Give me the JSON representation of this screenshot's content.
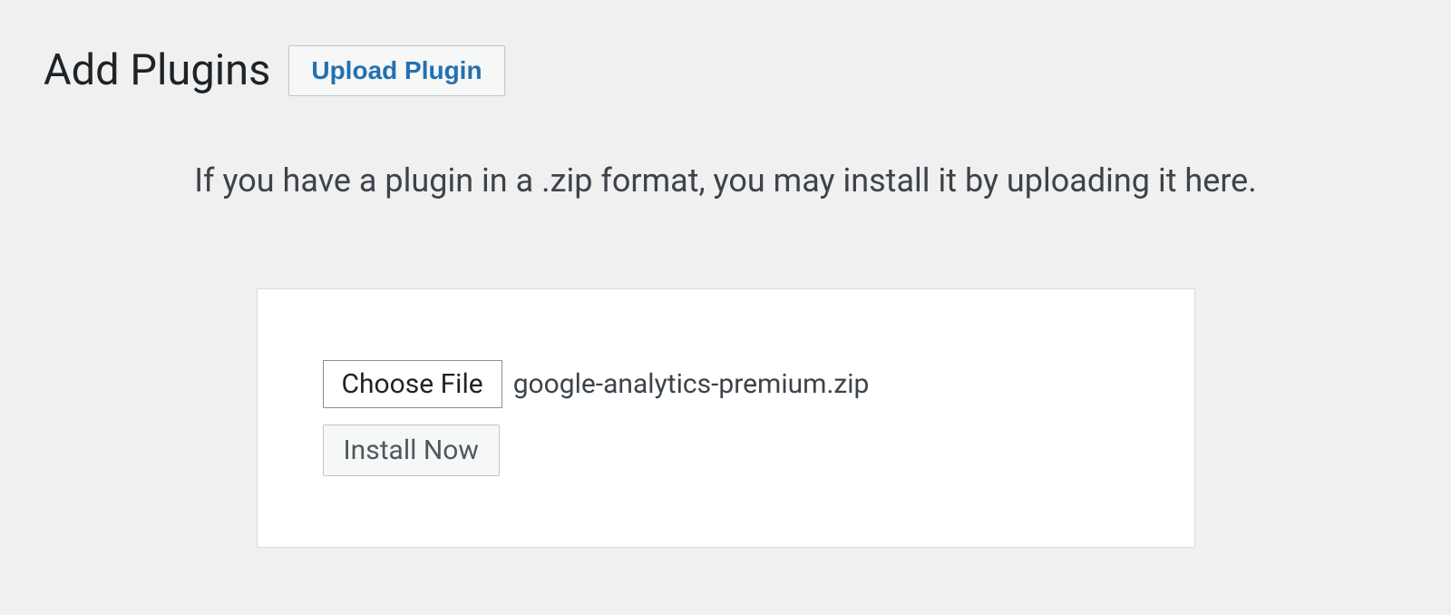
{
  "header": {
    "title": "Add Plugins",
    "upload_button": "Upload Plugin"
  },
  "help_text": "If you have a plugin in a .zip format, you may install it by uploading it here.",
  "form": {
    "choose_file_label": "Choose File",
    "selected_file": "google-analytics-premium.zip",
    "install_button": "Install Now"
  }
}
